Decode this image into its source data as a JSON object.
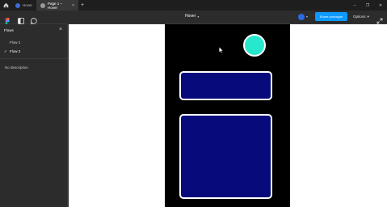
{
  "titlebar": {
    "tabs": [
      {
        "label": "Hover",
        "active": false
      },
      {
        "label": "Page 1 – Hover",
        "active": true
      }
    ],
    "new_tab": "+",
    "tab_close": "×",
    "window_controls": [
      "–",
      "❐",
      "✕"
    ]
  },
  "toolbar": {
    "title": "Hover",
    "share_label": "Share prototype",
    "options_label": "Options"
  },
  "sidebar": {
    "header": "Flows",
    "close": "×",
    "flows": [
      {
        "label": "Flow 1",
        "selected": false
      },
      {
        "label": "Flow 2",
        "selected": true
      }
    ],
    "description": "No description"
  },
  "colors": {
    "accent": "#0d99ff",
    "circle": "#27e8cc",
    "card_fill": "#070a7a",
    "frame_bg": "#000000"
  },
  "icons": [
    "home-icon",
    "figma-logo-icon",
    "sidebar-toggle-icon",
    "comment-icon",
    "expand-icon",
    "cursor-icon"
  ]
}
